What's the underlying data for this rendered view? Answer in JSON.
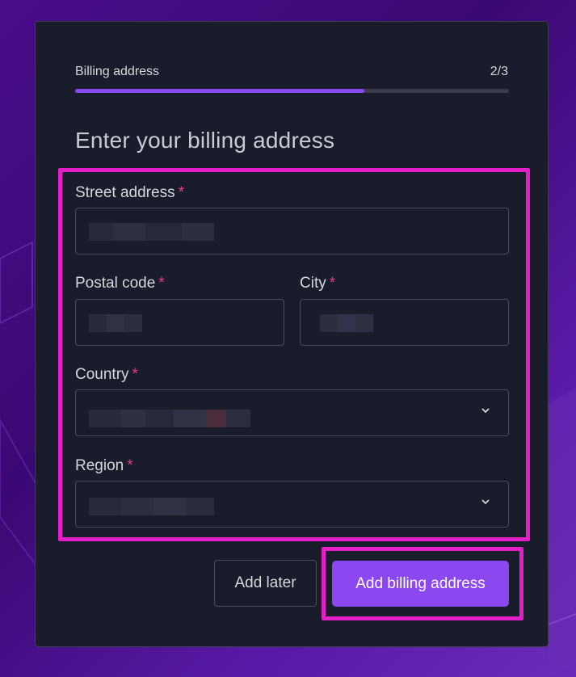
{
  "progress": {
    "label": "Billing address",
    "step": "2/3",
    "fraction": 0.667
  },
  "heading": "Enter your billing address",
  "form": {
    "street": {
      "label": "Street address",
      "required_mark": "*"
    },
    "postal": {
      "label": "Postal code",
      "required_mark": "*"
    },
    "city": {
      "label": "City",
      "required_mark": "*"
    },
    "country": {
      "label": "Country",
      "required_mark": "*",
      "icon": "chevron-down-icon"
    },
    "region": {
      "label": "Region",
      "required_mark": "*",
      "icon": "chevron-down-icon"
    }
  },
  "actions": {
    "later_label": "Add later",
    "submit_label": "Add billing address"
  },
  "colors": {
    "accent": "#8b47f0",
    "highlight": "#e51fc7",
    "required": "#e73a8a",
    "card_bg": "#181c2b"
  }
}
